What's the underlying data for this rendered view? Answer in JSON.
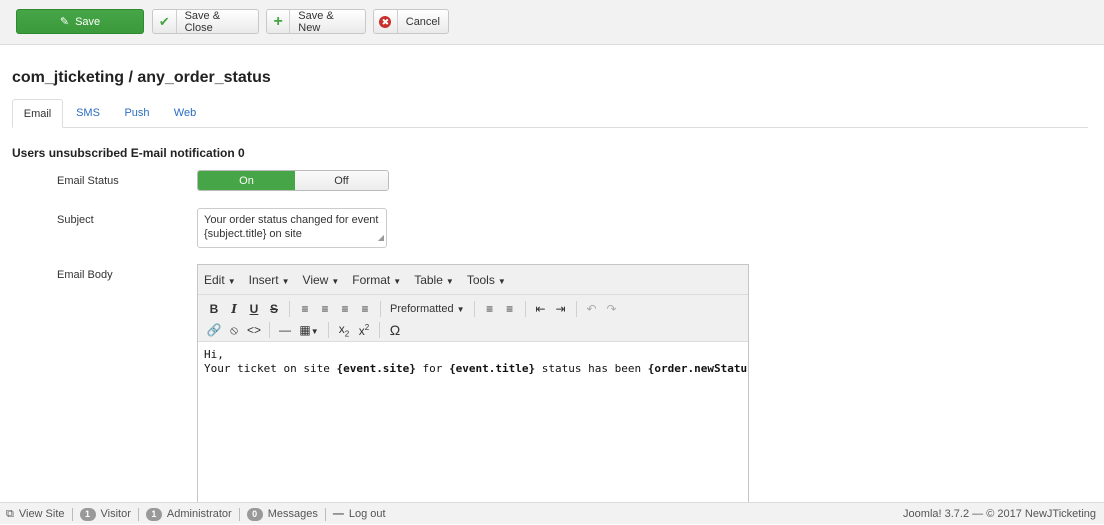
{
  "toolbar": {
    "save_label": "Save",
    "save_close_label": "Save & Close",
    "save_new_label": "Save & New",
    "cancel_label": "Cancel",
    "save_icon": "edit-icon",
    "save_close_icon": "checkmark-icon",
    "save_new_icon": "plus-icon",
    "cancel_icon": "cancel-circle-icon",
    "save_color": "#46a546",
    "cancel_color": "#c9302c"
  },
  "page_title": "com_jticketing / any_order_status",
  "tabs": [
    {
      "label": "Email",
      "active": true
    },
    {
      "label": "SMS",
      "active": false
    },
    {
      "label": "Push",
      "active": false
    },
    {
      "label": "Web",
      "active": false
    }
  ],
  "section_title": "Users unsubscribed E-mail notification 0",
  "fields": {
    "email_status": {
      "label": "Email Status",
      "on_label": "On",
      "off_label": "Off",
      "value": "On"
    },
    "subject": {
      "label": "Subject",
      "value": "Your order status changed for event {subject.title} on site"
    },
    "email_body": {
      "label": "Email Body"
    }
  },
  "editor": {
    "menus": [
      "Edit",
      "Insert",
      "View",
      "Format",
      "Table",
      "Tools"
    ],
    "format_select": "Preformatted",
    "row1_icons": [
      "bold-icon",
      "italic-icon",
      "underline-icon",
      "strikethrough-icon",
      "align-left-icon",
      "align-center-icon",
      "align-right-icon",
      "align-justify-icon",
      "bullet-list-icon",
      "numbered-list-icon",
      "outdent-icon",
      "indent-icon",
      "undo-icon",
      "redo-icon"
    ],
    "row2_icons": [
      "link-icon",
      "unlink-icon",
      "code-icon",
      "horizontal-rule-icon",
      "table-icon",
      "subscript-icon",
      "superscript-icon",
      "special-char-icon"
    ],
    "content": {
      "line1": "Hi,",
      "line2_parts": [
        {
          "text": "Your ticket on site ",
          "bold": false
        },
        {
          "text": "{event.site}",
          "bold": true
        },
        {
          "text": " for ",
          "bold": false
        },
        {
          "text": "{event.title}",
          "bold": true
        },
        {
          "text": " status has been ",
          "bold": false
        },
        {
          "text": "{order.newStatus}",
          "bold": true
        }
      ]
    }
  },
  "statusbar": {
    "view_site": "View Site",
    "visitor_count": "1",
    "visitor_label": "Visitor",
    "admin_count": "1",
    "admin_label": "Administrator",
    "messages_count": "0",
    "messages_label": "Messages",
    "logout_label": "Log out",
    "version_text": "Joomla! 3.7.2 — © 2017 NewJTicketing"
  }
}
